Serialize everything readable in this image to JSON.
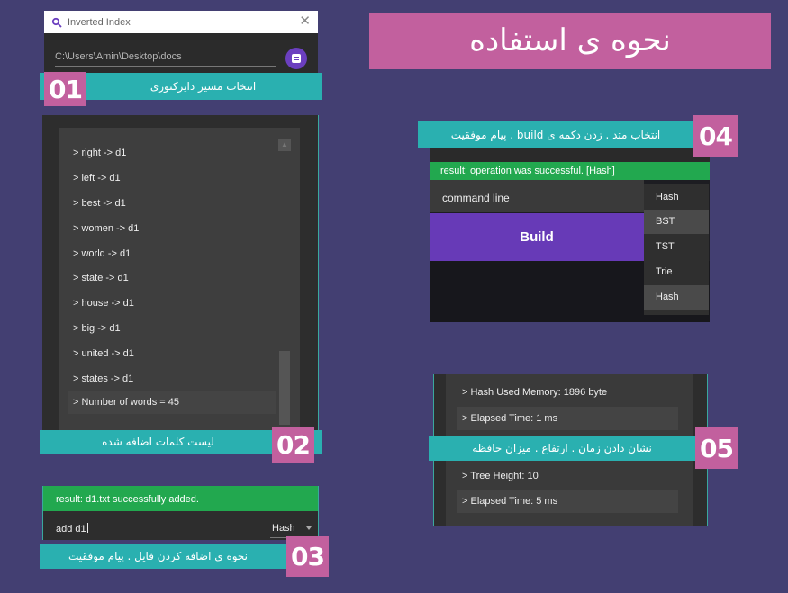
{
  "title_banner": "نحوه ی استفاده",
  "step01": {
    "badge": "01",
    "label": "انتخاب مسیر دایرکتوری",
    "window_title": "Inverted Index",
    "close_glyph": "✕",
    "path_value": "C:\\Users\\Amin\\Desktop\\docs",
    "title_icon": "magnifier-icon",
    "menu_icon": "document-menu-icon"
  },
  "step02": {
    "badge": "02",
    "label": "لیست کلمات اضافه شده",
    "rows": [
      "> right -> d1",
      "> left -> d1",
      "> best -> d1",
      "> women -> d1",
      "> world -> d1",
      "> state -> d1",
      "> house -> d1",
      "> big -> d1",
      "> united -> d1",
      "> states -> d1"
    ],
    "summary": "> Number of words = 45"
  },
  "step03": {
    "badge": "03",
    "label": "نحوه ی اضافه کردن فایل . پیام موفقیت",
    "result": "result: d1.txt successfully added.",
    "input_value": "add d1",
    "select_value": "Hash"
  },
  "step04": {
    "badge": "04",
    "label": "انتخاب متد . زدن دکمه ی build . پیام موفقیت",
    "result": "result: operation was successful. [Hash]",
    "command_line": "command line",
    "build_label": "Build",
    "options": [
      "Hash",
      "BST",
      "TST",
      "Trie",
      "Hash"
    ]
  },
  "step05": {
    "badge": "05",
    "label": "نشان دادن زمان . ارتفاع . میزان حافظه",
    "rows": [
      "> Hash Used Memory: 1896 byte",
      "> Elapsed Time: 1 ms",
      "> Tree Height: 10",
      "> Elapsed Time: 5 ms"
    ]
  },
  "colors": {
    "background": "#433f72",
    "accent_pink": "#c2609e",
    "accent_teal": "#2ab0b0",
    "success_green": "#22a84f",
    "build_purple": "#673ab7"
  }
}
